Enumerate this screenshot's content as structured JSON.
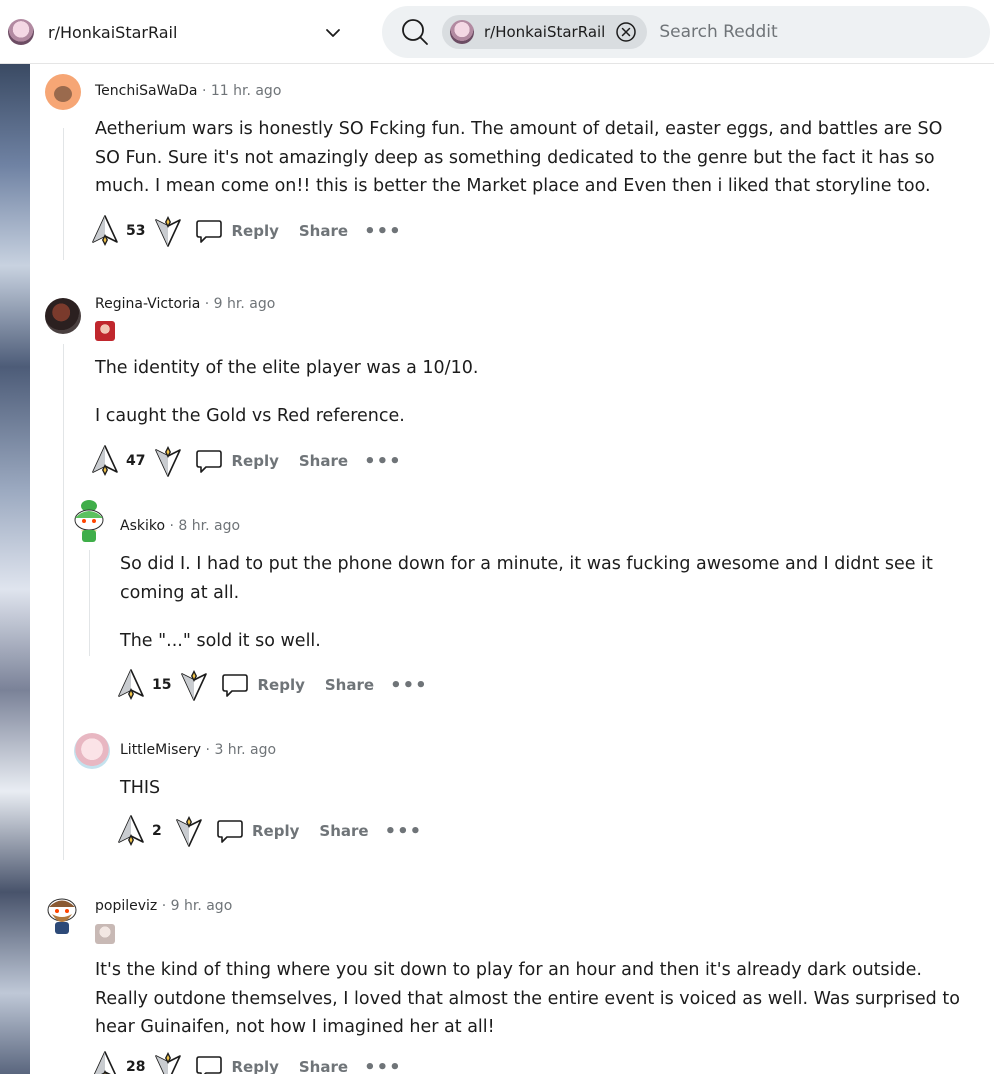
{
  "header": {
    "subreddit": "r/HonkaiStarRail",
    "search_chip": "r/HonkaiStarRail",
    "search_placeholder": "Search Reddit"
  },
  "actions": {
    "reply": "Reply",
    "share": "Share",
    "more": "•••"
  },
  "comments": [
    {
      "username": "TenchiSaWaDa",
      "separator": "·",
      "time": "11 hr. ago",
      "paragraphs": [
        "Aetherium wars is honestly SO Fcking fun. The amount of detail, easter eggs, and battles are SO SO Fun. Sure it's not amazingly deep as something dedicated to the genre but the fact it has so much. I mean come on!! this is better the Market place and Even then i liked that storyline too."
      ],
      "score": "53"
    },
    {
      "username": "Regina-Victoria",
      "separator": "·",
      "time": "9 hr. ago",
      "paragraphs": [
        "The identity of the elite player was a 10/10.",
        "I caught the Gold vs Red reference."
      ],
      "score": "47"
    },
    {
      "username": "Askiko",
      "separator": "·",
      "time": "8 hr. ago",
      "paragraphs": [
        "So did I. I had to put the phone down for a minute, it was fucking awesome and I didnt see it coming at all.",
        "The \"...\" sold it so well."
      ],
      "score": "15"
    },
    {
      "username": "LittleMisery",
      "separator": "·",
      "time": "3 hr. ago",
      "paragraphs": [
        "THIS"
      ],
      "score": "2"
    },
    {
      "username": "popileviz",
      "separator": "·",
      "time": "9 hr. ago",
      "paragraphs": [
        "It's the kind of thing where you sit down to play for an hour and then it's already dark outside. Really outdone themselves, I loved that almost the entire event is voiced as well. Was surprised to hear Guinaifen, not how I imagined her at all!"
      ],
      "score": "28"
    }
  ]
}
